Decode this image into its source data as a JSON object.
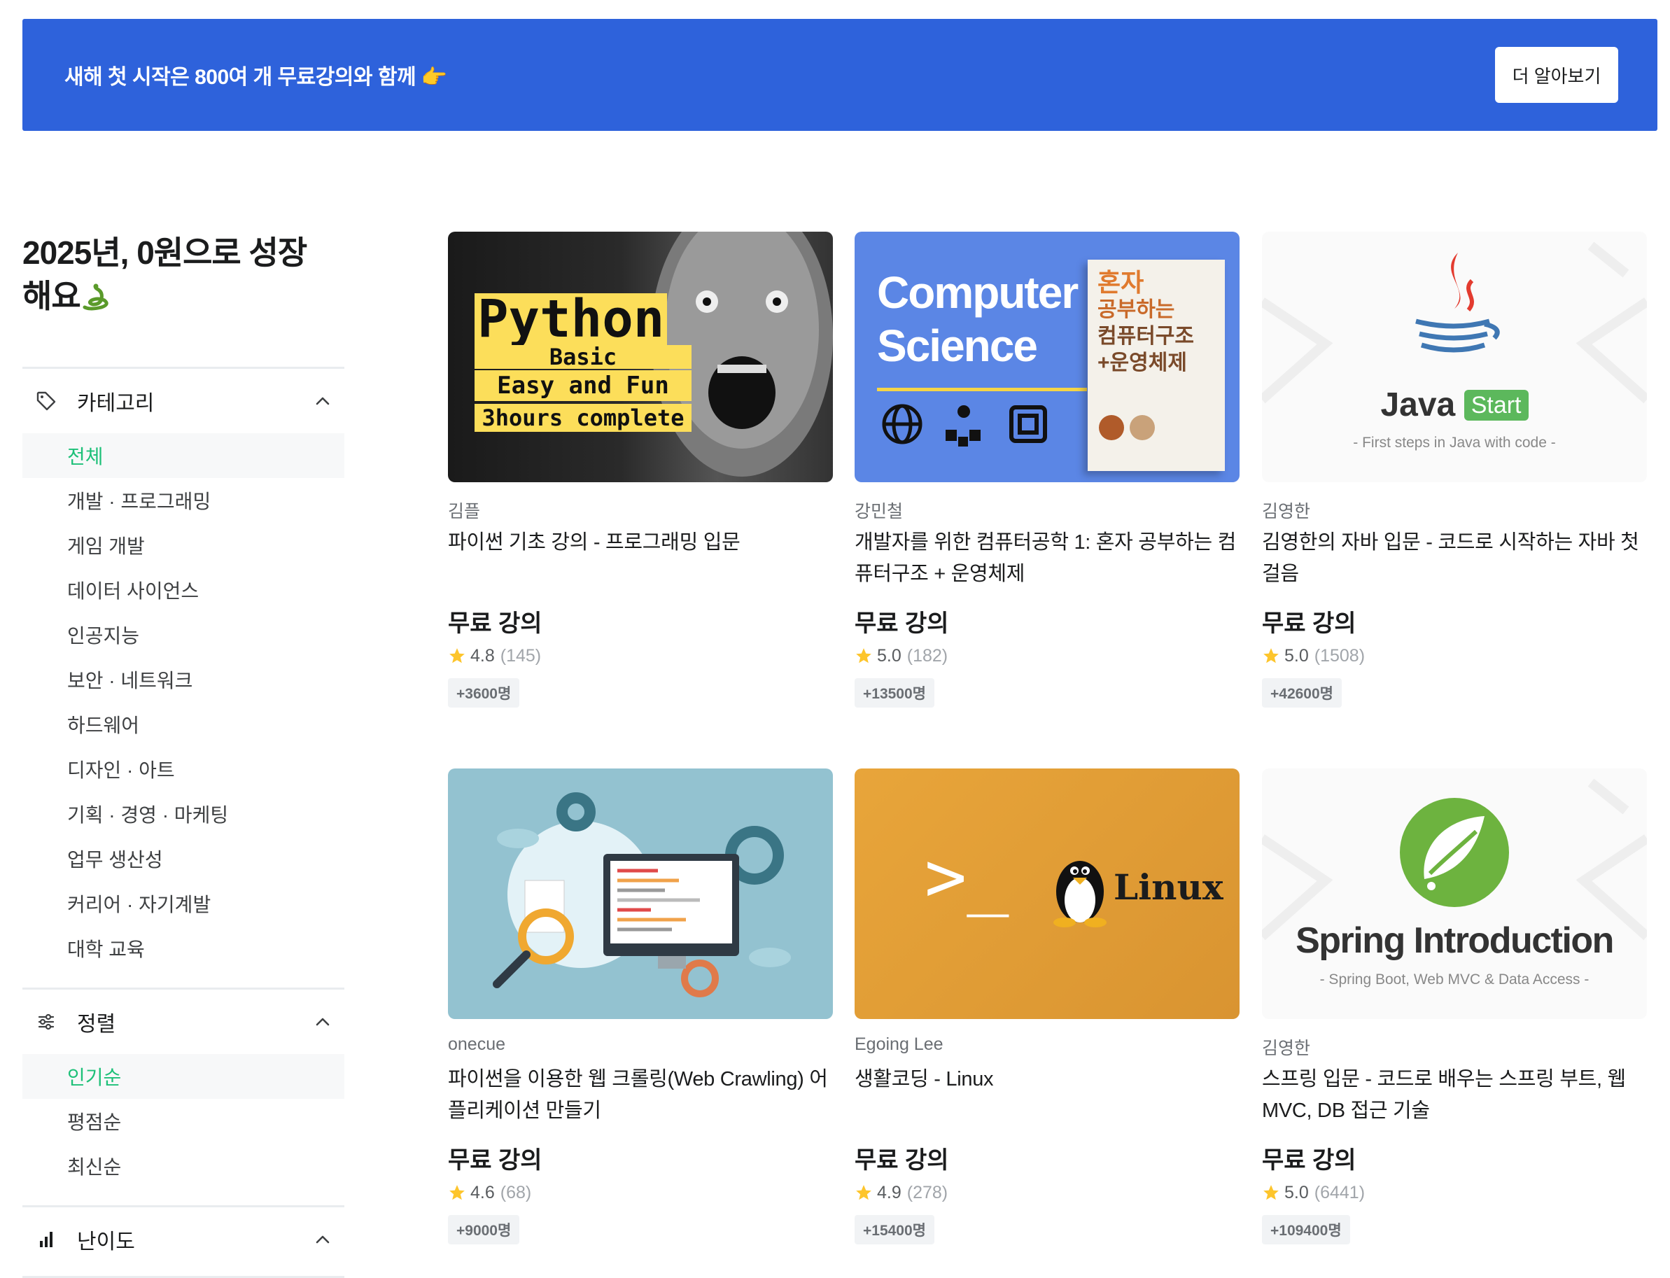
{
  "banner": {
    "text": "새해 첫 시작은 800여 개 무료강의와 함께 👉",
    "button": "더 알아보기"
  },
  "sidebar": {
    "title_line1": "2025년, 0원으로 성장",
    "title_line2": "해요",
    "category": {
      "label": "카테고리",
      "items": [
        "전체",
        "개발 · 프로그래밍",
        "게임 개발",
        "데이터 사이언스",
        "인공지능",
        "보안 · 네트워크",
        "하드웨어",
        "디자인 · 아트",
        "기획 · 경영 · 마케팅",
        "업무 생산성",
        "커리어 · 자기계발",
        "대학 교육"
      ]
    },
    "sort": {
      "label": "정렬",
      "items": [
        "인기순",
        "평점순",
        "최신순"
      ]
    },
    "difficulty": {
      "label": "난이도"
    }
  },
  "courses": [
    {
      "author": "김플",
      "title": "파이썬 기초 강의 - 프로그래밍 입문",
      "price": "무료 강의",
      "rating": "4.8",
      "reviews": "(145)",
      "students": "+3600명",
      "thumb": {
        "l1": "Python",
        "l2": "Basic",
        "l3": "Easy and Fun",
        "l4": "3hours complete"
      }
    },
    {
      "author": "강민철",
      "title": "개발자를 위한 컴퓨터공학 1: 혼자 공부하는 컴퓨터구조 + 운영체제",
      "price": "무료 강의",
      "rating": "5.0",
      "reviews": "(182)",
      "students": "+13500명",
      "thumb": {
        "l1": "Computer",
        "l2": "Science",
        "book1": "혼자",
        "book2": "공부하는",
        "book3": "컴퓨터구조",
        "book4": "+운영체제"
      }
    },
    {
      "author": "김영한",
      "title": "김영한의 자바 입문 - 코드로 시작하는 자바 첫걸음",
      "price": "무료 강의",
      "rating": "5.0",
      "reviews": "(1508)",
      "students": "+42600명",
      "thumb": {
        "l1": "Java",
        "l2": "Start",
        "l3": "- First steps in Java with code -"
      }
    },
    {
      "author": "onecue",
      "title": "파이썬을 이용한 웹 크롤링(Web Crawling) 어플리케이션 만들기",
      "price": "무료 강의",
      "rating": "4.6",
      "reviews": "(68)",
      "students": "+9000명"
    },
    {
      "author": "Egoing Lee",
      "title": "생활코딩 - Linux",
      "price": "무료 강의",
      "rating": "4.9",
      "reviews": "(278)",
      "students": "+15400명",
      "thumb": {
        "l1": ">_",
        "l2": "Linux"
      }
    },
    {
      "author": "김영한",
      "title": "스프링 입문 - 코드로 배우는 스프링 부트, 웹 MVC, DB 접근 기술",
      "price": "무료 강의",
      "rating": "5.0",
      "reviews": "(6441)",
      "students": "+109400명",
      "thumb": {
        "l1": "Spring Introduction",
        "l2": "- Spring Boot, Web MVC & Data Access -"
      }
    }
  ],
  "colors": {
    "banner": "#2e62db",
    "accent": "#1dc078",
    "star": "#fdc52c"
  }
}
